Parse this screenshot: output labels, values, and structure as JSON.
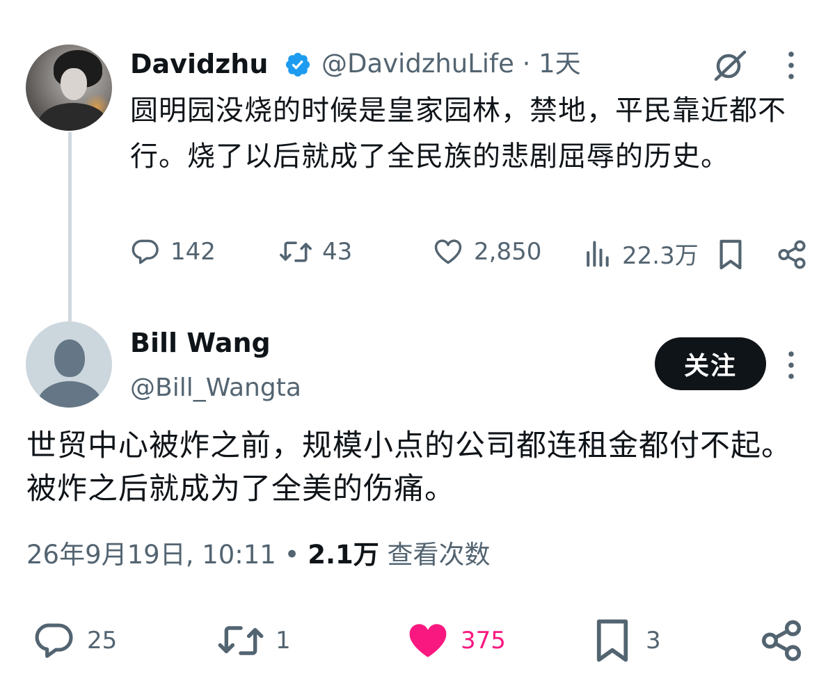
{
  "colors": {
    "text": "#0f1419",
    "secondary": "#536471",
    "verified": "#1d9bf0",
    "like_active": "#f91880",
    "thread_line": "#cfd9de",
    "button_bg": "#0f1419"
  },
  "parent_tweet": {
    "name": "Davidzhu",
    "handle_time": "@DavidzhuLife · 1天",
    "text": "圆明园没烧的时候是皇家园林，禁地，平民靠近都不行。烧了以后就成了全民族的悲剧屈辱的历史。",
    "actions": {
      "replies": "142",
      "retweets": "43",
      "likes": "2,850",
      "views": "22.3万"
    },
    "icons": [
      "verified-badge-icon",
      "grok-icon",
      "more-icon",
      "reply-icon",
      "retweet-icon",
      "like-icon",
      "views-icon",
      "bookmark-icon",
      "share-icon"
    ]
  },
  "reply_tweet": {
    "name": "Bill Wang",
    "handle": "@Bill_Wangta",
    "follow_label": "关注",
    "text": "世贸中心被炸之前，规模小点的公司都连租金都付不起。被炸之后就成为了全美的伤痛。",
    "timestamp": "26年9月19日, 10:11",
    "separator": " • ",
    "views_count": "2.1万",
    "views_label": " 查看次数",
    "actions": {
      "replies": "25",
      "retweets": "1",
      "likes": "375",
      "bookmarks": "3"
    },
    "liked": true
  }
}
